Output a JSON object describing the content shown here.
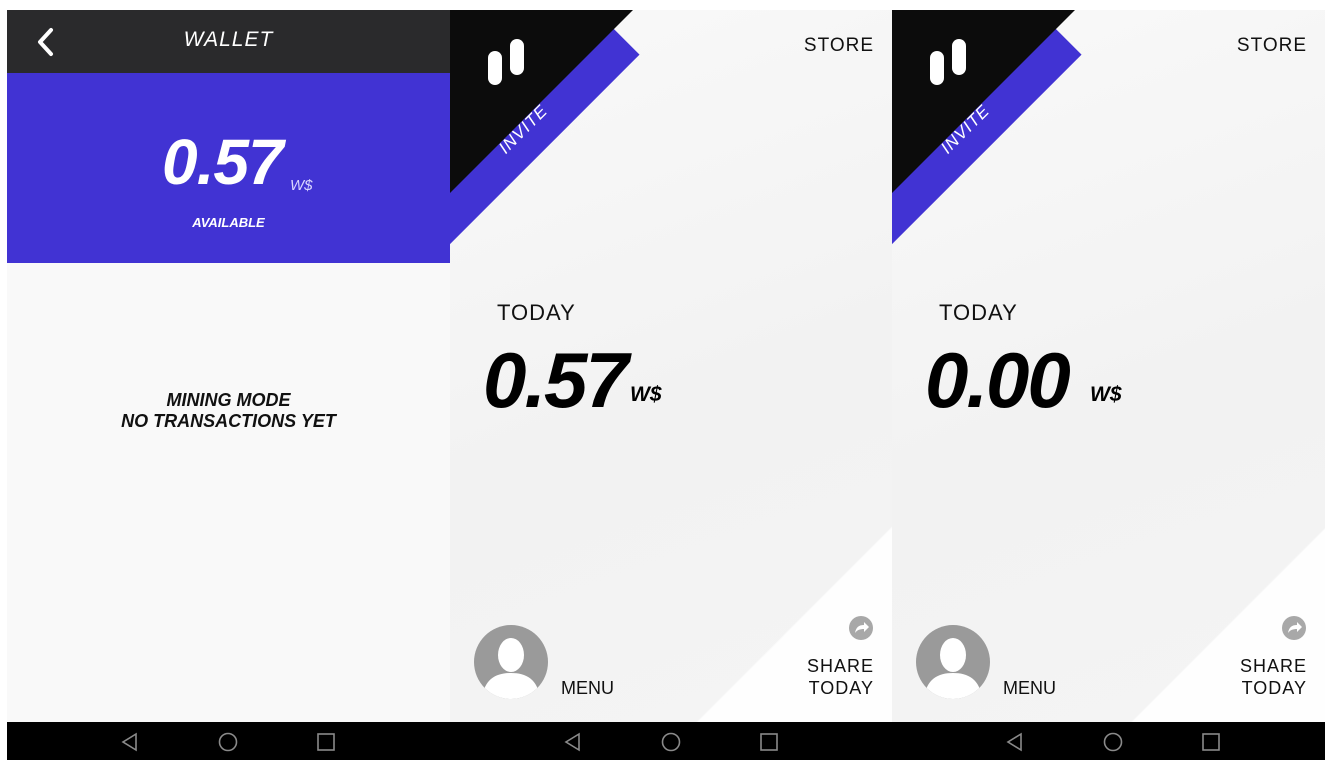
{
  "wallet": {
    "title": "WALLET",
    "balance": "0.57",
    "unit": "W$",
    "available_label": "AVAILABLE",
    "empty_line1": "MINING MODE",
    "empty_line2": "NO TRANSACTIONS YET",
    "accent_color": "#4133d3",
    "icons": {
      "back": "back-arrow-icon"
    }
  },
  "home_screens": [
    {
      "store_label": "STORE",
      "invite_label": "INVITE",
      "today_label": "TODAY",
      "today_amount": "0.57",
      "unit": "W$",
      "menu_label": "MENU",
      "share_line1": "SHARE",
      "share_line2": "TODAY"
    },
    {
      "store_label": "STORE",
      "invite_label": "INVITE",
      "today_label": "TODAY",
      "today_amount": "0.00",
      "unit": "W$",
      "menu_label": "MENU",
      "share_line1": "SHARE",
      "share_line2": "TODAY"
    }
  ],
  "navigation": {
    "icons": [
      "nav-back-icon",
      "nav-home-icon",
      "nav-recents-icon"
    ]
  },
  "colors": {
    "accent": "#4133d3",
    "dark": "#0c0c0c",
    "background": "#f6f6f6"
  }
}
